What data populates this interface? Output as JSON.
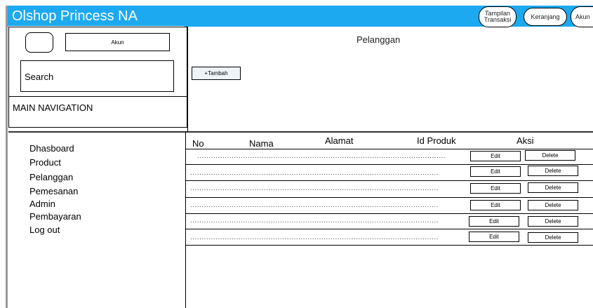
{
  "app": {
    "brand": "Olshop Princess NA"
  },
  "topnav": {
    "transaksi_label": "Tampilan Transaksi",
    "keranjang_label": "Keranjang",
    "akun_label": "Akun"
  },
  "sidebar": {
    "akun_button": "Akun",
    "search_label": "Search",
    "main_nav": "MAIN NAVIGATION",
    "items": [
      "Dhasboard",
      "Product",
      "Pelanggan",
      "Pemesanan",
      "Admin",
      "Pembayaran",
      "Log out"
    ]
  },
  "main": {
    "title": "Pelanggan",
    "add_button": "+Tambah"
  },
  "table": {
    "columns": [
      "No",
      "Nama",
      "Alamat",
      "Id Produk",
      "Aksi"
    ],
    "edit_label": "Edit",
    "delete_label": "Delete",
    "placeholder": "............................................................................................................"
  }
}
